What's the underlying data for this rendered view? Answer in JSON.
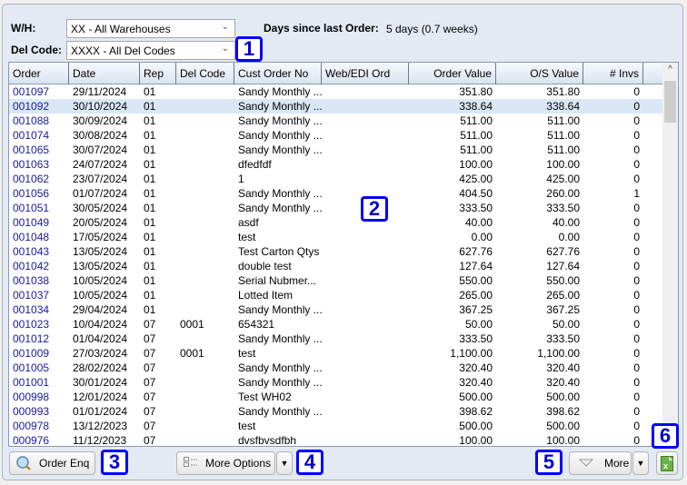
{
  "filters": {
    "warehouse_label": "W/H:",
    "warehouse_value": "XX - All Warehouses",
    "delcode_label": "Del Code:",
    "delcode_value": "XXXX - All Del Codes",
    "days_label": "Days since last Order:",
    "days_value": "5 days (0.7 weeks)"
  },
  "grid": {
    "columns": [
      "Order",
      "Date",
      "Rep",
      "Del Code",
      "Cust Order No",
      "Web/EDI Ord",
      "Order Value",
      "O/S Value",
      "# Invs"
    ],
    "selected_row": 1,
    "rows": [
      [
        "001097",
        "29/11/2024",
        "01",
        "",
        "Sandy Monthly ...",
        "",
        "351.80",
        "351.80",
        "0"
      ],
      [
        "001092",
        "30/10/2024",
        "01",
        "",
        "Sandy Monthly ...",
        "",
        "338.64",
        "338.64",
        "0"
      ],
      [
        "001088",
        "30/09/2024",
        "01",
        "",
        "Sandy Monthly ...",
        "",
        "511.00",
        "511.00",
        "0"
      ],
      [
        "001074",
        "30/08/2024",
        "01",
        "",
        "Sandy Monthly ...",
        "",
        "511.00",
        "511.00",
        "0"
      ],
      [
        "001065",
        "30/07/2024",
        "01",
        "",
        "Sandy Monthly ...",
        "",
        "511.00",
        "511.00",
        "0"
      ],
      [
        "001063",
        "24/07/2024",
        "01",
        "",
        "dfedfdf",
        "",
        "100.00",
        "100.00",
        "0"
      ],
      [
        "001062",
        "23/07/2024",
        "01",
        "",
        "1",
        "",
        "425.00",
        "425.00",
        "0"
      ],
      [
        "001056",
        "01/07/2024",
        "01",
        "",
        "Sandy Monthly ...",
        "",
        "404.50",
        "260.00",
        "1"
      ],
      [
        "001051",
        "30/05/2024",
        "01",
        "",
        "Sandy Monthly ...",
        "",
        "333.50",
        "333.50",
        "0"
      ],
      [
        "001049",
        "20/05/2024",
        "01",
        "",
        "asdf",
        "",
        "40.00",
        "40.00",
        "0"
      ],
      [
        "001048",
        "17/05/2024",
        "01",
        "",
        "test",
        "",
        "0.00",
        "0.00",
        "0"
      ],
      [
        "001043",
        "13/05/2024",
        "01",
        "",
        "Test Carton Qtys",
        "",
        "627.76",
        "627.76",
        "0"
      ],
      [
        "001042",
        "13/05/2024",
        "01",
        "",
        "double test",
        "",
        "127.64",
        "127.64",
        "0"
      ],
      [
        "001038",
        "10/05/2024",
        "01",
        "",
        "Serial Nubmer...",
        "",
        "550.00",
        "550.00",
        "0"
      ],
      [
        "001037",
        "10/05/2024",
        "01",
        "",
        "Lotted Item",
        "",
        "265.00",
        "265.00",
        "0"
      ],
      [
        "001034",
        "29/04/2024",
        "01",
        "",
        "Sandy Monthly ...",
        "",
        "367.25",
        "367.25",
        "0"
      ],
      [
        "001023",
        "10/04/2024",
        "07",
        "0001",
        "654321",
        "",
        "50.00",
        "50.00",
        "0"
      ],
      [
        "001012",
        "01/04/2024",
        "07",
        "",
        "Sandy Monthly ...",
        "",
        "333.50",
        "333.50",
        "0"
      ],
      [
        "001009",
        "27/03/2024",
        "07",
        "0001",
        "test",
        "",
        "1,100.00",
        "1,100.00",
        "0"
      ],
      [
        "001005",
        "28/02/2024",
        "07",
        "",
        "Sandy Monthly ...",
        "",
        "320.40",
        "320.40",
        "0"
      ],
      [
        "001001",
        "30/01/2024",
        "07",
        "",
        "Sandy Monthly ...",
        "",
        "320.40",
        "320.40",
        "0"
      ],
      [
        "000998",
        "12/01/2024",
        "07",
        "",
        "Test WH02",
        "",
        "500.00",
        "500.00",
        "0"
      ],
      [
        "000993",
        "01/01/2024",
        "07",
        "",
        "Sandy Monthly ...",
        "",
        "398.62",
        "398.62",
        "0"
      ],
      [
        "000978",
        "13/12/2023",
        "07",
        "",
        "test",
        "",
        "500.00",
        "500.00",
        "0"
      ],
      [
        "000976",
        "11/12/2023",
        "07",
        "",
        "dvsfbvsdfbh",
        "",
        "100.00",
        "100.00",
        "0"
      ]
    ]
  },
  "buttons": {
    "order_enq": "Order Enq",
    "more_options": "More Options",
    "more": "More"
  },
  "annotations": [
    "1",
    "2",
    "3",
    "4",
    "5",
    "6"
  ],
  "colors": {
    "order_link": "#1a1aa0",
    "selected_row": "#dae8f5",
    "annotation_border": "#0000ff"
  }
}
